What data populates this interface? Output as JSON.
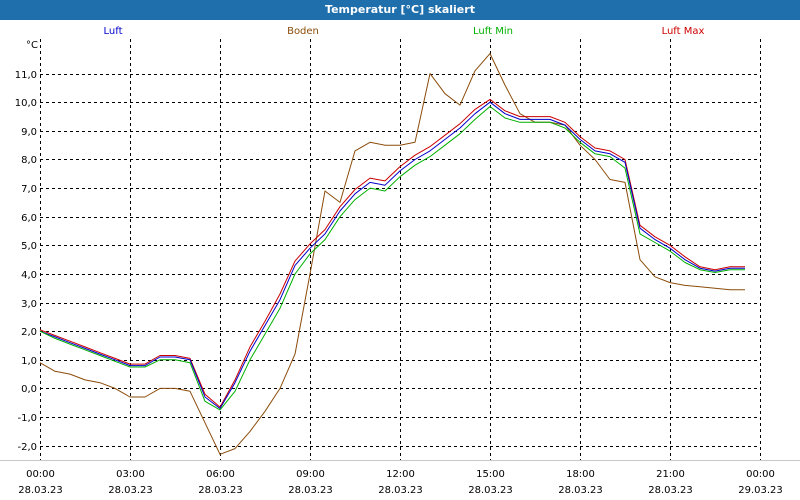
{
  "window": {
    "title": "Temperatur [°C] skaliert"
  },
  "chart_data": {
    "type": "line",
    "title": "Temperatur [°C] skaliert",
    "ylabel": "°C",
    "xlabel": "",
    "ylim": [
      -2.5,
      12.0
    ],
    "xlim": [
      0,
      24
    ],
    "yticks": [
      "-2,0",
      "-1,0",
      "0,0",
      "1,0",
      "2,0",
      "3,0",
      "4,0",
      "5,0",
      "6,0",
      "7,0",
      "8,0",
      "9,0",
      "10,0",
      "11,0"
    ],
    "xticks": [
      {
        "time": "00:00",
        "date": "28.03.23"
      },
      {
        "time": "03:00",
        "date": "28.03.23"
      },
      {
        "time": "06:00",
        "date": "28.03.23"
      },
      {
        "time": "09:00",
        "date": "28.03.23"
      },
      {
        "time": "12:00",
        "date": "28.03.23"
      },
      {
        "time": "15:00",
        "date": "28.03.23"
      },
      {
        "time": "18:00",
        "date": "28.03.23"
      },
      {
        "time": "21:00",
        "date": "28.03.23"
      },
      {
        "time": "00:00",
        "date": "29.03.23"
      }
    ],
    "grid": true,
    "legend_position": "top",
    "series": [
      {
        "name": "Luft",
        "color": "#0000cc",
        "x": [
          0,
          0.5,
          1,
          1.5,
          2,
          2.5,
          3,
          3.5,
          4,
          4.5,
          5,
          5.5,
          6,
          6.5,
          7,
          7.5,
          8,
          8.5,
          9,
          9.5,
          10,
          10.5,
          11,
          11.5,
          12,
          12.5,
          13,
          13.5,
          14,
          14.5,
          15,
          15.5,
          16,
          16.5,
          17,
          17.5,
          18,
          18.5,
          19,
          19.5,
          20,
          20.5,
          21,
          21.5,
          22,
          22.5,
          23,
          23.5
        ],
        "values": [
          2.0,
          1.8,
          1.6,
          1.4,
          1.2,
          1.0,
          0.8,
          0.8,
          1.1,
          1.1,
          1.0,
          -0.3,
          -0.7,
          0.2,
          1.3,
          2.2,
          3.1,
          4.3,
          4.9,
          5.4,
          6.2,
          6.8,
          7.2,
          7.1,
          7.6,
          8.0,
          8.3,
          8.7,
          9.1,
          9.6,
          10.0,
          9.6,
          9.4,
          9.4,
          9.4,
          9.2,
          8.7,
          8.3,
          8.2,
          7.9,
          5.6,
          5.2,
          4.9,
          4.5,
          4.2,
          4.1,
          4.2,
          4.2
        ]
      },
      {
        "name": "Boden",
        "color": "#8b4c0a",
        "x": [
          0,
          0.5,
          1,
          1.5,
          2,
          2.5,
          3,
          3.5,
          4,
          4.5,
          5,
          5.5,
          6,
          6.5,
          7,
          7.5,
          8,
          8.5,
          9,
          9.5,
          10,
          10.5,
          11,
          11.5,
          12,
          12.5,
          13,
          13.5,
          14,
          14.5,
          15,
          15.5,
          16,
          16.5,
          17,
          17.5,
          18,
          18.5,
          19,
          19.5,
          20,
          20.5,
          21,
          21.5,
          22,
          22.5,
          23,
          23.5
        ],
        "values": [
          0.9,
          0.6,
          0.5,
          0.3,
          0.2,
          0.0,
          -0.3,
          -0.3,
          0.0,
          0.0,
          -0.1,
          -1.2,
          -2.3,
          -2.1,
          -1.5,
          -0.8,
          0.0,
          1.2,
          4.0,
          6.9,
          6.5,
          8.3,
          8.6,
          8.5,
          8.5,
          8.6,
          11.0,
          10.3,
          9.9,
          11.1,
          11.7,
          10.6,
          9.6,
          9.3,
          9.3,
          9.2,
          8.5,
          8.0,
          7.3,
          7.2,
          4.5,
          3.9,
          3.7,
          3.6,
          3.55,
          3.5,
          3.45,
          3.45
        ]
      },
      {
        "name": "Luft Min",
        "color": "#00b000",
        "x": [
          0,
          0.5,
          1,
          1.5,
          2,
          2.5,
          3,
          3.5,
          4,
          4.5,
          5,
          5.5,
          6,
          6.5,
          7,
          7.5,
          8,
          8.5,
          9,
          9.5,
          10,
          10.5,
          11,
          11.5,
          12,
          12.5,
          13,
          13.5,
          14,
          14.5,
          15,
          15.5,
          16,
          16.5,
          17,
          17.5,
          18,
          18.5,
          19,
          19.5,
          20,
          20.5,
          21,
          21.5,
          22,
          22.5,
          23,
          23.5
        ],
        "values": [
          2.0,
          1.75,
          1.55,
          1.35,
          1.15,
          0.95,
          0.75,
          0.75,
          1.0,
          1.0,
          0.9,
          -0.45,
          -0.75,
          -0.1,
          1.0,
          1.9,
          2.8,
          4.0,
          4.7,
          5.2,
          6.0,
          6.6,
          7.0,
          6.9,
          7.4,
          7.8,
          8.1,
          8.5,
          8.9,
          9.4,
          9.85,
          9.45,
          9.3,
          9.3,
          9.3,
          9.1,
          8.6,
          8.2,
          8.1,
          7.7,
          5.4,
          5.1,
          4.8,
          4.4,
          4.15,
          4.05,
          4.15,
          4.15
        ]
      },
      {
        "name": "Luft Max",
        "color": "#cc0000",
        "x": [
          0,
          0.5,
          1,
          1.5,
          2,
          2.5,
          3,
          3.5,
          4,
          4.5,
          5,
          5.5,
          6,
          6.5,
          7,
          7.5,
          8,
          8.5,
          9,
          9.5,
          10,
          10.5,
          11,
          11.5,
          12,
          12.5,
          13,
          13.5,
          14,
          14.5,
          15,
          15.5,
          16,
          16.5,
          17,
          17.5,
          18,
          18.5,
          19,
          19.5,
          20,
          20.5,
          21,
          21.5,
          22,
          22.5,
          23,
          23.5
        ],
        "values": [
          2.05,
          1.85,
          1.65,
          1.45,
          1.25,
          1.05,
          0.85,
          0.85,
          1.15,
          1.15,
          1.05,
          -0.2,
          -0.65,
          0.3,
          1.45,
          2.35,
          3.3,
          4.45,
          5.05,
          5.55,
          6.35,
          6.95,
          7.35,
          7.25,
          7.75,
          8.15,
          8.45,
          8.85,
          9.25,
          9.75,
          10.1,
          9.7,
          9.5,
          9.5,
          9.5,
          9.3,
          8.8,
          8.4,
          8.3,
          8.0,
          5.7,
          5.3,
          5.0,
          4.6,
          4.25,
          4.15,
          4.25,
          4.25
        ]
      }
    ]
  }
}
